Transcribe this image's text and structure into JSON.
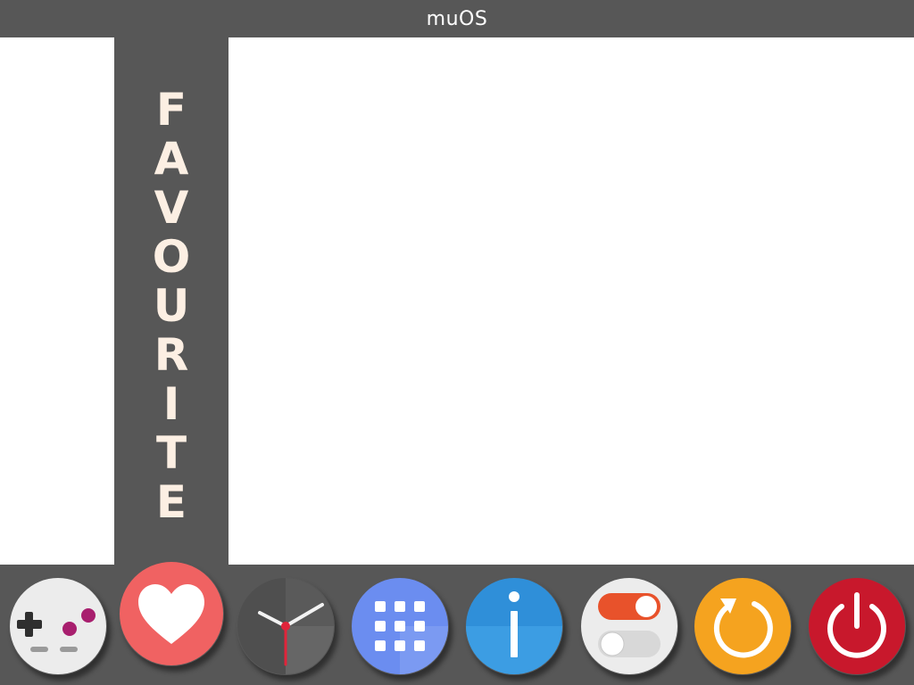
{
  "header": {
    "title": "muOS"
  },
  "panel": {
    "label": "FAVOURITE",
    "letters": [
      "F",
      "A",
      "V",
      "O",
      "U",
      "R",
      "I",
      "T",
      "E"
    ]
  },
  "dock": {
    "selected": "favourite",
    "items": [
      {
        "id": "explore",
        "icon": "gamepad-icon"
      },
      {
        "id": "favourite",
        "icon": "heart-icon"
      },
      {
        "id": "clock",
        "icon": "clock-icon"
      },
      {
        "id": "apps",
        "icon": "app-grid-icon"
      },
      {
        "id": "info",
        "icon": "info-icon"
      },
      {
        "id": "config",
        "icon": "toggle-icon"
      },
      {
        "id": "reboot",
        "icon": "refresh-icon"
      },
      {
        "id": "shutdown",
        "icon": "power-icon"
      }
    ]
  },
  "colors": {
    "bar": "#575757",
    "letters": "#fcefe3",
    "heart": "#f06262",
    "apps": "#6b8df0",
    "info": "#2f8fd9",
    "toggle_on": "#e8522b",
    "reboot": "#f5a31f",
    "power": "#c8182c"
  }
}
